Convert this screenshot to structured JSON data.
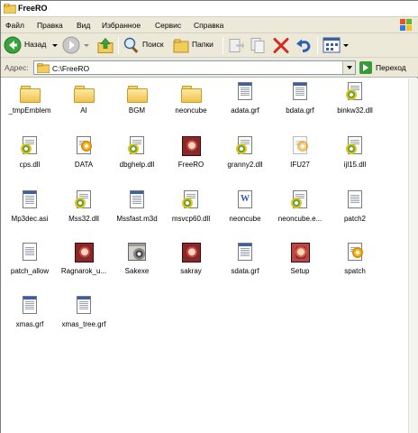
{
  "window": {
    "title": "FreeRO"
  },
  "menu": [
    "Файл",
    "Правка",
    "Вид",
    "Избранное",
    "Сервис",
    "Справка"
  ],
  "toolbar": {
    "back_label": "Назад",
    "search_label": "Поиск",
    "folders_label": "Папки"
  },
  "address": {
    "label": "Адрес:",
    "path": "C:\\FreeRO",
    "go_label": "Переход"
  },
  "files": [
    {
      "name": "_tmpEmblem",
      "type": "folder"
    },
    {
      "name": "AI",
      "type": "folder"
    },
    {
      "name": "BGM",
      "type": "folder"
    },
    {
      "name": "neoncube",
      "type": "folder"
    },
    {
      "name": "adata.grf",
      "type": "doc"
    },
    {
      "name": "bdata.grf",
      "type": "doc"
    },
    {
      "name": "binkw32.dll",
      "type": "dll"
    },
    {
      "name": "cps.dll",
      "type": "dll"
    },
    {
      "name": "DATA",
      "type": "ini"
    },
    {
      "name": "dbghelp.dll",
      "type": "dll"
    },
    {
      "name": "FreeRO",
      "type": "app"
    },
    {
      "name": "granny2.dll",
      "type": "dll"
    },
    {
      "name": "IFU27",
      "type": "ini-light"
    },
    {
      "name": "ijl15.dll",
      "type": "dll"
    },
    {
      "name": "Mp3dec.asi",
      "type": "doc"
    },
    {
      "name": "Mss32.dll",
      "type": "dll"
    },
    {
      "name": "Mssfast.m3d",
      "type": "doc"
    },
    {
      "name": "msvcp60.dll",
      "type": "dll"
    },
    {
      "name": "neoncube",
      "type": "word"
    },
    {
      "name": "neoncube.e...",
      "type": "dll"
    },
    {
      "name": "patch2",
      "type": "page"
    },
    {
      "name": "patch_allow",
      "type": "page"
    },
    {
      "name": "Ragnarok_u...",
      "type": "app"
    },
    {
      "name": "Sakexe",
      "type": "setupwin"
    },
    {
      "name": "sakray",
      "type": "app"
    },
    {
      "name": "sdata.grf",
      "type": "doc"
    },
    {
      "name": "Setup",
      "type": "app2"
    },
    {
      "name": "spatch",
      "type": "ini"
    },
    {
      "name": "xmas.grf",
      "type": "doc"
    },
    {
      "name": "xmas_tree.grf",
      "type": "doc"
    }
  ]
}
